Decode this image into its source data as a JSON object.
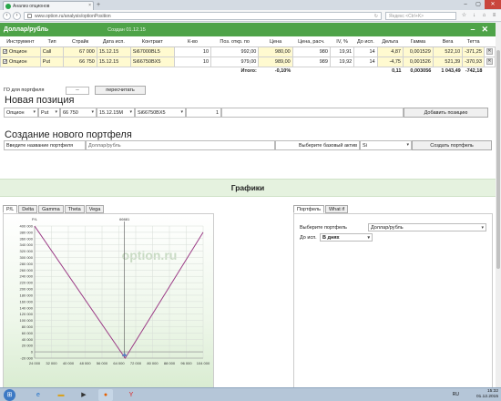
{
  "browser": {
    "tab_title": "Анализ опционов",
    "tab_close": "×",
    "new_tab": "+",
    "url": "www.option.ru/analysis/optionPosition",
    "search_placeholder": "Яндекс <Ctrl+K>",
    "window_controls": [
      "–",
      "▢",
      "✕"
    ]
  },
  "portfolio": {
    "title": "Доллар/рубль",
    "created": "Создан 01.12.15",
    "controls": [
      "–",
      "✕"
    ],
    "columns": [
      "Инструмент",
      "Тип",
      "Страйк",
      "Дата исп.",
      "Контракт",
      "К-во",
      "Поз. откр. по",
      "Цена",
      "Цена, расч.",
      "IV, %",
      "До исп.",
      "Дельта",
      "Гамма",
      "Вега",
      "Тетта"
    ],
    "rows": [
      {
        "instrument": "Опцион",
        "type": "Call",
        "strike": "67 000",
        "date": "15.12.15",
        "contract": "Si67000BL5",
        "qty": "10",
        "open_price": "992,00",
        "price": "980,00",
        "calc_price": "980",
        "iv": "19,91",
        "days": "14",
        "delta": "4,87",
        "gamma": "0,001529",
        "vega": "522,10",
        "theta": "-371,25"
      },
      {
        "instrument": "Опцион",
        "type": "Put",
        "strike": "66 750",
        "date": "15.12.15",
        "contract": "Si66750BX5",
        "qty": "10",
        "open_price": "979,00",
        "price": "989,00",
        "calc_price": "989",
        "iv": "19,92",
        "days": "14",
        "delta": "-4,75",
        "gamma": "0,001526",
        "vega": "521,39",
        "theta": "-370,93"
      }
    ],
    "total": {
      "label": "Итого:",
      "pct": "-0,10%",
      "delta": "0,11",
      "gamma": "0,003056",
      "vega": "1 043,49",
      "theta": "-742,18"
    }
  },
  "go": {
    "label": "ГО для портфеля",
    "value": "--",
    "button": "пересчитать"
  },
  "new_position": {
    "title": "Новая позиция",
    "instrument": "Опцион",
    "type": "Put",
    "strike": "66 750",
    "date": "15.12.15M",
    "contract": "Si66750BX5",
    "qty": "1",
    "button": "Добавить позицию"
  },
  "new_portfolio": {
    "title": "Создание нового портфеля",
    "name_label": "Введите название портфеля",
    "name_value": "Доллар/рубль",
    "asset_label": "Выберите базовый актив",
    "asset_value": "Si",
    "button": "Создать портфель"
  },
  "graphs": {
    "title": "Графики",
    "left_tabs": [
      "P/L",
      "Delta",
      "Gamma",
      "Theta",
      "Vega"
    ],
    "right_tabs": [
      "Портфель",
      "What if"
    ],
    "watermark": "option.ru",
    "portfolio_label": "Выберите портфель",
    "portfolio_value": "Доллар/рубль",
    "till_label": "До исп.",
    "till_value": "В днях"
  },
  "chart_data": {
    "type": "line",
    "series": [
      {
        "x": [
          24000,
          67000,
          104000
        ],
        "y": [
          400000,
          -20000,
          380000
        ]
      }
    ],
    "xlim": [
      24000,
      104000
    ],
    "ylim": [
      -20000,
      400000
    ],
    "x_ticks": [
      "24 000",
      "32 000",
      "40 000",
      "48 000",
      "56 000",
      "64 000",
      "72 000",
      "80 000",
      "88 000",
      "96 000",
      "104 000"
    ],
    "y_ticks": [
      "400 000",
      "380 000",
      "360 000",
      "340 000",
      "320 000",
      "300 000",
      "280 000",
      "260 000",
      "240 000",
      "220 000",
      "200 000",
      "180 000",
      "160 000",
      "140 000",
      "120 000",
      "100 000",
      "80 000",
      "60 000",
      "40 000",
      "20 000",
      "0",
      "-20 000"
    ],
    "ylabel": "P/L",
    "top_label": "66681",
    "current_price": 66681,
    "grid": true,
    "line_color": "#9b3b86"
  },
  "taskbar": {
    "start": "⊞",
    "lang": "RU",
    "time": "15:32",
    "date": "01.12.2015"
  },
  "colors": {
    "accent": "#4ea348",
    "row_highlight": "#fffad0"
  }
}
